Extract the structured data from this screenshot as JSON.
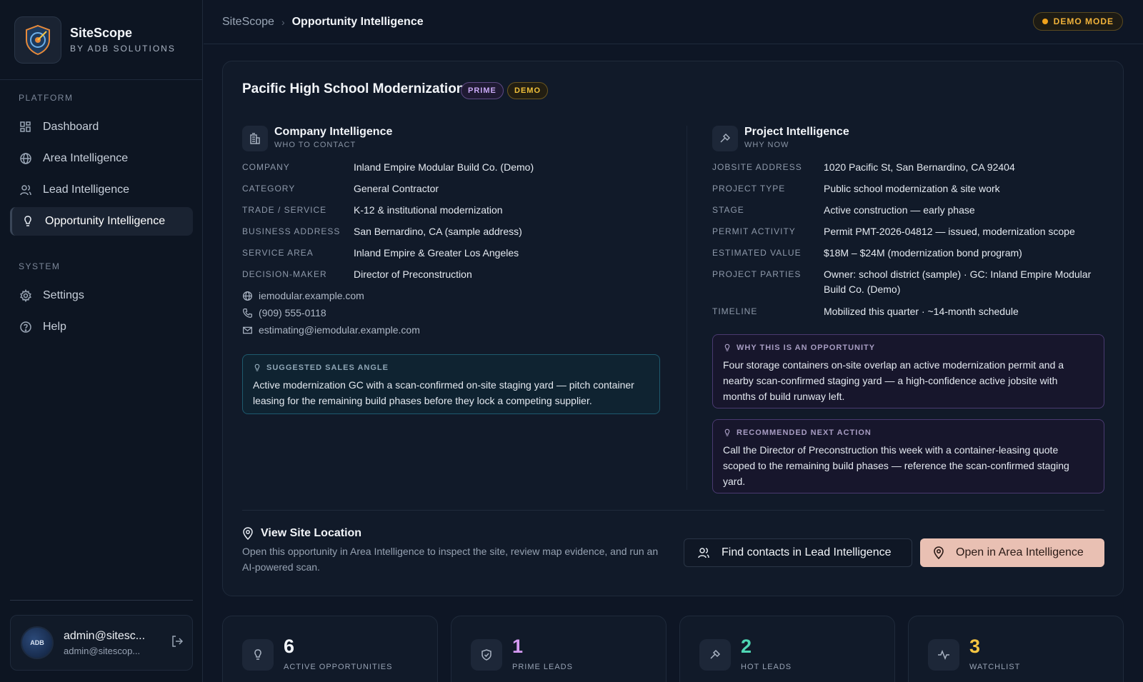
{
  "brand": {
    "name": "SiteScope",
    "sub": "BY ADB SOLUTIONS"
  },
  "nav": {
    "platform_label": "PLATFORM",
    "system_label": "SYSTEM",
    "items": [
      {
        "label": "Dashboard",
        "icon": "grid-icon"
      },
      {
        "label": "Area Intelligence",
        "icon": "globe-icon"
      },
      {
        "label": "Lead Intelligence",
        "icon": "users-icon"
      },
      {
        "label": "Opportunity Intelligence",
        "icon": "lightbulb-icon",
        "active": true
      },
      {
        "label": "Settings",
        "icon": "gear-icon"
      },
      {
        "label": "Help",
        "icon": "help-icon"
      }
    ]
  },
  "user": {
    "name": "admin@sitesc...",
    "email": "admin@sitescop...",
    "avatar_text": "ADB"
  },
  "breadcrumb": {
    "root": "SiteScope",
    "current": "Opportunity Intelligence"
  },
  "demo_mode": "DEMO MODE",
  "opportunity": {
    "title": "Pacific High School Modernization",
    "badges": {
      "prime": "PRIME",
      "demo": "DEMO"
    },
    "company": {
      "title": "Company Intelligence",
      "subtitle": "WHO TO CONTACT",
      "fields": [
        {
          "label": "COMPANY",
          "value": "Inland Empire Modular Build Co. (Demo)"
        },
        {
          "label": "CATEGORY",
          "value": "General Contractor"
        },
        {
          "label": "TRADE / SERVICE",
          "value": "K-12 & institutional modernization"
        },
        {
          "label": "BUSINESS ADDRESS",
          "value": "San Bernardino, CA (sample address)"
        },
        {
          "label": "SERVICE AREA",
          "value": "Inland Empire & Greater Los Angeles"
        },
        {
          "label": "DECISION-MAKER",
          "value": "Director of Preconstruction"
        }
      ],
      "website": "iemodular.example.com",
      "phone": "(909) 555-0118",
      "email": "estimating@iemodular.example.com",
      "angle_title": "SUGGESTED SALES ANGLE",
      "angle_body": "Active modernization GC with a scan-confirmed on-site staging yard — pitch container leasing for the remaining build phases before they lock a competing supplier."
    },
    "project": {
      "title": "Project Intelligence",
      "subtitle": "WHY NOW",
      "fields": [
        {
          "label": "JOBSITE ADDRESS",
          "value": "1020 Pacific St, San Bernardino, CA 92404"
        },
        {
          "label": "PROJECT TYPE",
          "value": "Public school modernization & site work"
        },
        {
          "label": "STAGE",
          "value": "Active construction — early phase"
        },
        {
          "label": "PERMIT ACTIVITY",
          "value": "Permit PMT-2026-04812 — issued, modernization scope"
        },
        {
          "label": "ESTIMATED VALUE",
          "value": "$18M – $24M (modernization bond program)"
        },
        {
          "label": "PROJECT PARTIES",
          "value": "Owner: school district (sample) · GC: Inland Empire Modular Build Co. (Demo)"
        },
        {
          "label": "TIMELINE",
          "value": "Mobilized this quarter · ~14-month schedule"
        }
      ],
      "why_title": "WHY THIS IS AN OPPORTUNITY",
      "why_body": "Four storage containers on-site overlap an active modernization permit and a nearby scan-confirmed staging yard — a high-confidence active jobsite with months of build runway left.",
      "next_title": "RECOMMENDED NEXT ACTION",
      "next_body": "Call the Director of Preconstruction this week with a container-leasing quote scoped to the remaining build phases — reference the scan-confirmed staging yard."
    },
    "site": {
      "title": "View Site Location",
      "desc": "Open this opportunity in Area Intelligence to inspect the site, review map evidence, and run an AI-powered scan.",
      "btn_contacts": "Find contacts in Lead Intelligence",
      "btn_area": "Open in Area Intelligence"
    }
  },
  "stats": [
    {
      "value": "6",
      "label": "ACTIVE OPPORTUNITIES",
      "color": "#f2f5f9"
    },
    {
      "value": "1",
      "label": "PRIME LEADS",
      "color": "#d59af2"
    },
    {
      "value": "2",
      "label": "HOT LEADS",
      "color": "#4fd6b4"
    },
    {
      "value": "3",
      "label": "WATCHLIST",
      "color": "#f5c542"
    }
  ]
}
